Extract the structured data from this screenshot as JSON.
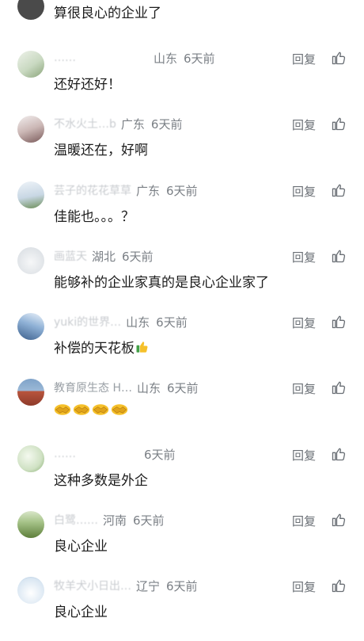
{
  "top_comment": {
    "content": "算很良心的企业了"
  },
  "comments": [
    {
      "username": "……",
      "location": "山东",
      "time": "6天前",
      "content": "还好还好！",
      "reply_label": "回复",
      "avatar_color": "#dfe7d9"
    },
    {
      "username": "不水火土…b",
      "location": "广东",
      "time": "6天前",
      "content": "温暖还在，好啊",
      "reply_label": "回复",
      "avatar_color": "#c7b7b5"
    },
    {
      "username": "芸子的花花草草",
      "location": "广东",
      "time": "6天前",
      "content": "佳能也。。。？",
      "reply_label": "回复",
      "avatar_color": "#c8d7e4"
    },
    {
      "username": "画蓝天",
      "location": "湖北",
      "time": "6天前",
      "content": "能够补的企业家真的是良心企业家了",
      "reply_label": "回复",
      "avatar_color": "#e3e6ea"
    },
    {
      "username": "yuki的世界…",
      "location": "山东",
      "time": "6天前",
      "content": "补偿的天花板",
      "content_emoji": "thumbs-up",
      "reply_label": "回复",
      "avatar_color": "#8fb1d6"
    },
    {
      "username": "教育原生态 H…",
      "location": "山东",
      "time": "6天前",
      "content": "",
      "content_emoji": "handshake-x4",
      "reply_label": "回复",
      "avatar_color": "#b9553d"
    },
    {
      "username": "……",
      "location": "",
      "time": "6天前",
      "content": "这种多数是外企",
      "reply_label": "回复",
      "avatar_color": "#cfe1c3"
    },
    {
      "username": "白鹭……",
      "location": "河南",
      "time": "6天前",
      "content": "良心企业",
      "reply_label": "回复",
      "avatar_color": "#8cae6a"
    },
    {
      "username": "牧羊犬小日出…",
      "location": "辽宁",
      "time": "6天前",
      "content": "良心企业",
      "reply_label": "回复",
      "avatar_color": "#d9e6f2"
    }
  ],
  "colors": {
    "meta_text": "#7a7f85",
    "username": "#9aa0a6",
    "content": "#1c1c1c",
    "icon": "#6a6f75"
  },
  "icons": {
    "like": "thumbs-up-outline-icon"
  }
}
